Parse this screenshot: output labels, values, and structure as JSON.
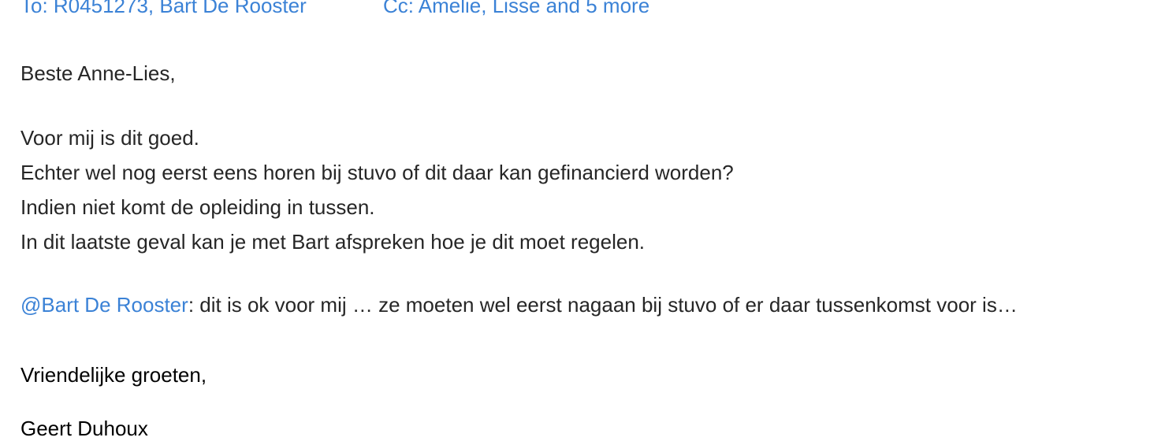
{
  "header": {
    "to": "To: R0451273, Bart De Rooster",
    "cc": "Cc: Amelie, Lisse and 5 more"
  },
  "message": {
    "greeting": "Beste Anne-Lies,",
    "paragraph_lines": [
      "Voor mij is dit goed.",
      "Echter wel nog eerst eens horen bij stuvo of dit daar kan gefinancierd worden?",
      "Indien niet komt de opleiding in tussen.",
      "In dit laatste geval kan je met Bart afspreken hoe je dit moet regelen."
    ],
    "mention_name": "@Bart De Rooster",
    "mention_text": ": dit is ok voor mij … ze moeten wel eerst nagaan bij  stuvo of er daar tussenkomst voor is…",
    "closing": "Vriendelijke groeten,",
    "signature_name": "Geert Duhoux"
  },
  "colors": {
    "link": "#3b82d6",
    "body_text": "#262626",
    "signature_text": "#000000",
    "background": "#ffffff"
  }
}
